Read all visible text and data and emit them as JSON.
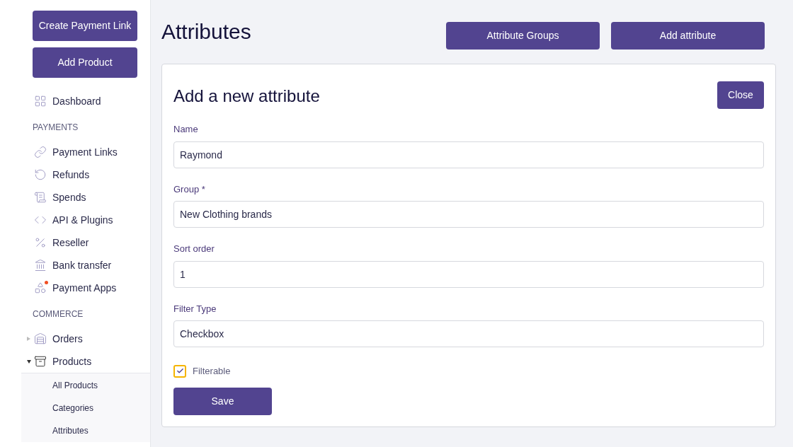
{
  "sidebar": {
    "buttons": [
      "Create Payment Link",
      "Add Product"
    ],
    "items": [
      {
        "kind": "item",
        "label": "Dashboard",
        "badge": false
      },
      {
        "kind": "header",
        "label": "PAYMENTS"
      },
      {
        "kind": "item",
        "label": "Payment Links",
        "badge": false
      },
      {
        "kind": "item",
        "label": "Refunds",
        "badge": false
      },
      {
        "kind": "item",
        "label": "Spends",
        "badge": false
      },
      {
        "kind": "item",
        "label": "API & Plugins",
        "badge": false
      },
      {
        "kind": "item",
        "label": "Reseller",
        "badge": false
      },
      {
        "kind": "item",
        "label": "Bank transfer",
        "badge": false
      },
      {
        "kind": "item",
        "label": "Payment Apps",
        "badge": true
      },
      {
        "kind": "header",
        "label": "COMMERCE"
      },
      {
        "kind": "item",
        "label": "Orders",
        "expanded": false
      },
      {
        "kind": "item",
        "label": "Products",
        "expanded": true,
        "children": [
          {
            "label": "All Products"
          },
          {
            "label": "Categories"
          },
          {
            "label": "Attributes"
          }
        ]
      }
    ]
  },
  "page": {
    "title": "Attributes",
    "actions": [
      "Attribute Groups",
      "Add attribute"
    ]
  },
  "form": {
    "title": "Add a new attribute",
    "close": "Close",
    "fields": [
      {
        "label": "Name",
        "value": "Raymond"
      },
      {
        "label": "Group *",
        "value": "New Clothing brands"
      },
      {
        "label": "Sort order",
        "value": "1"
      },
      {
        "label": "Filter Type",
        "value": "Checkbox"
      }
    ],
    "checkbox": {
      "label": "Filterable",
      "checked": true
    },
    "submit": "Save"
  }
}
